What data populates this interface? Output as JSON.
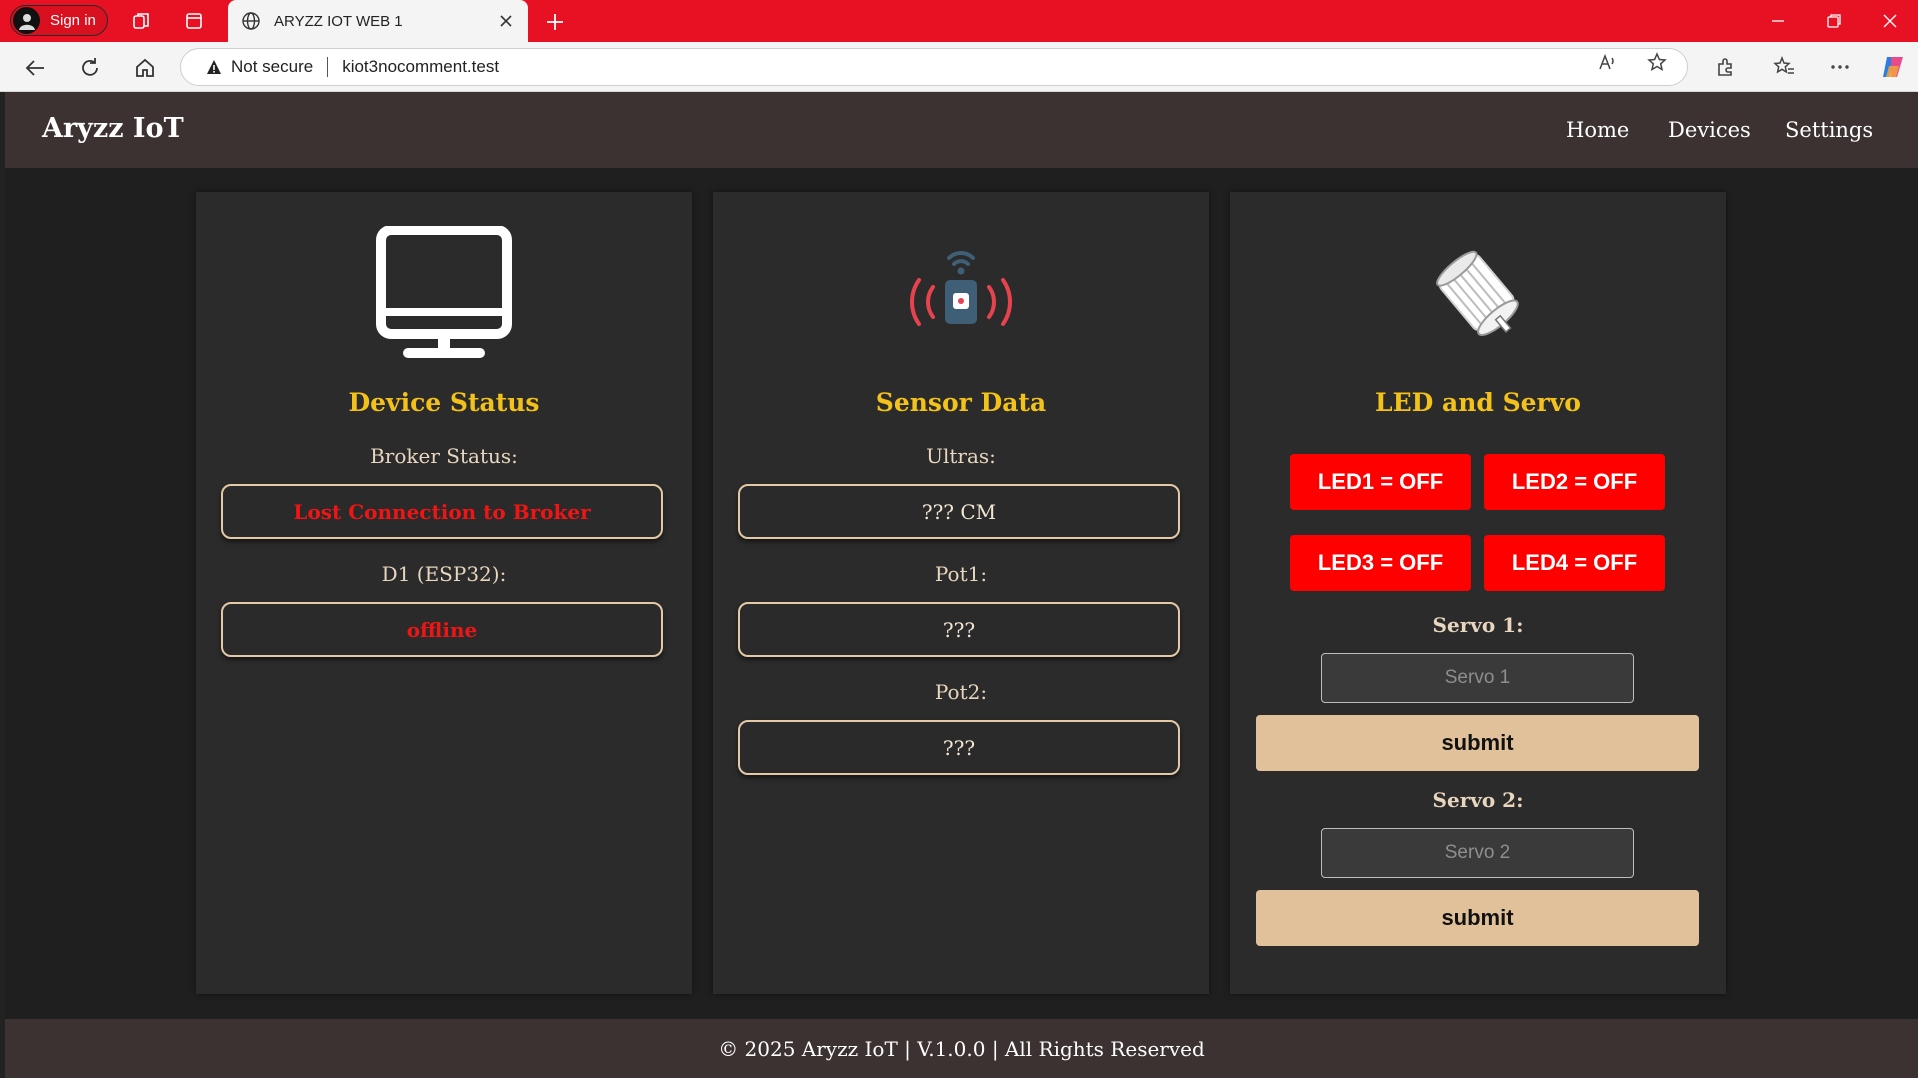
{
  "browser": {
    "signin_label": "Sign in",
    "tab_title": "ARYZZ IOT WEB 1",
    "security_label": "Not secure",
    "url": "kiot3nocomment.test",
    "accent": "#e81123"
  },
  "site": {
    "brand": "Aryzz IoT",
    "nav": [
      "Home",
      "Devices",
      "Settings"
    ],
    "footer": "© 2025 Aryzz IoT | V.1.0.0 | All Rights Reserved"
  },
  "device_status": {
    "title": "Device Status",
    "icon": "monitor-icon",
    "broker_label": "Broker Status:",
    "broker_value": "Lost Connection to Broker",
    "d1_label": "D1 (ESP32):",
    "d1_value": "offline"
  },
  "sensor_data": {
    "title": "Sensor Data",
    "icon": "wireless-sensor-icon",
    "ultras_label": "Ultras:",
    "ultras_value": "??? CM",
    "pot1_label": "Pot1:",
    "pot1_value": "???",
    "pot2_label": "Pot2:",
    "pot2_value": "???"
  },
  "led_servo": {
    "title": "LED and Servo",
    "icon": "servo-motor-icon",
    "leds": [
      "LED1 = OFF",
      "LED2 = OFF",
      "LED3 = OFF",
      "LED4 = OFF"
    ],
    "servo1_label": "Servo 1:",
    "servo1_placeholder": "Servo 1",
    "servo2_label": "Servo 2:",
    "servo2_placeholder": "Servo 2",
    "submit_label": "submit"
  },
  "colors": {
    "title_yellow": "#f3c21a",
    "status_red": "#f01515",
    "led_red": "#ff0000",
    "submit_tan": "#e1c199",
    "box_border": "#e3c9a5"
  }
}
